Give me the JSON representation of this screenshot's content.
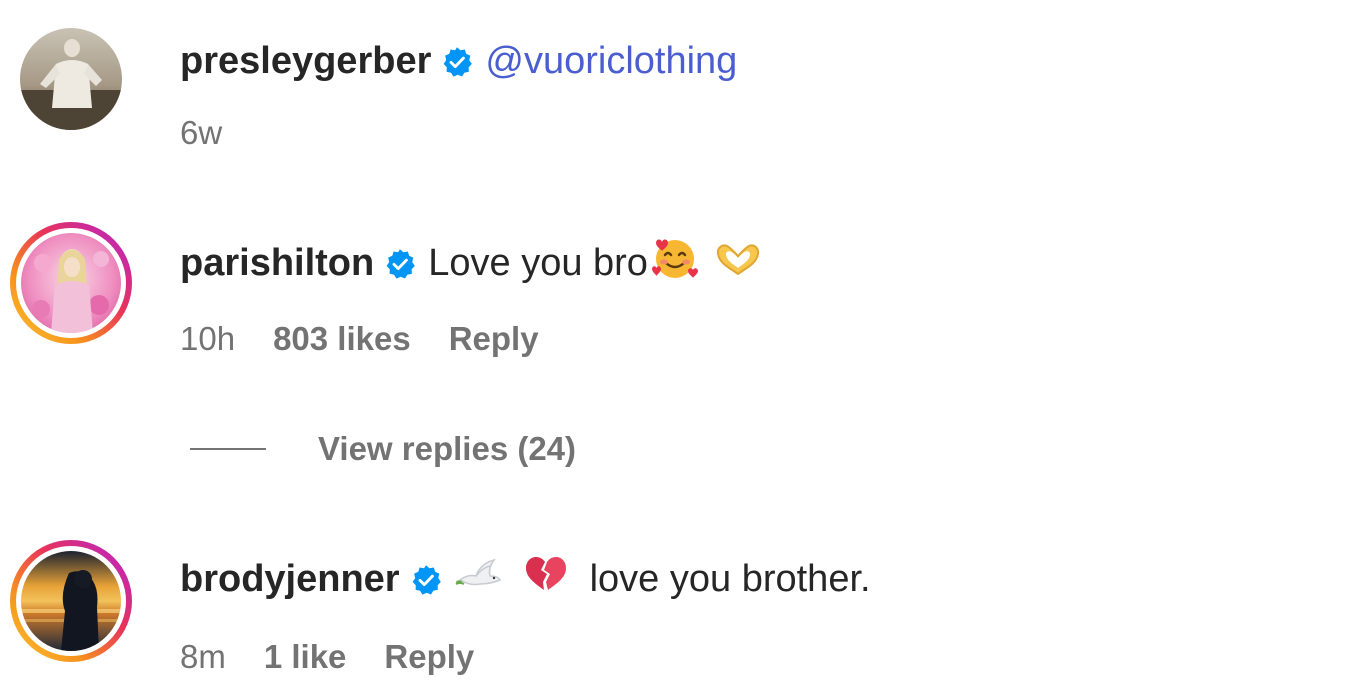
{
  "comments": [
    {
      "username": "presleygerber",
      "verified": true,
      "mention": "@vuoriclothing",
      "text": "",
      "time": "6w",
      "likes": "",
      "reply": ""
    },
    {
      "username": "parishilton",
      "verified": true,
      "mention": "",
      "text": "Love you bro",
      "emojis": [
        "smiling-face-with-hearts",
        "heart-hands"
      ],
      "time": "10h",
      "likes": "803 likes",
      "reply": "Reply",
      "view_replies": "View replies (24)"
    },
    {
      "username": "brodyjenner",
      "verified": true,
      "mention": "",
      "emojis": [
        "dove",
        "broken-heart"
      ],
      "text": "love you brother.",
      "time": "8m",
      "likes": "1 like",
      "reply": "Reply"
    }
  ],
  "colors": {
    "verified": "#0095f6",
    "mention": "#4a5ecf",
    "muted": "#737373",
    "text": "#262626"
  }
}
